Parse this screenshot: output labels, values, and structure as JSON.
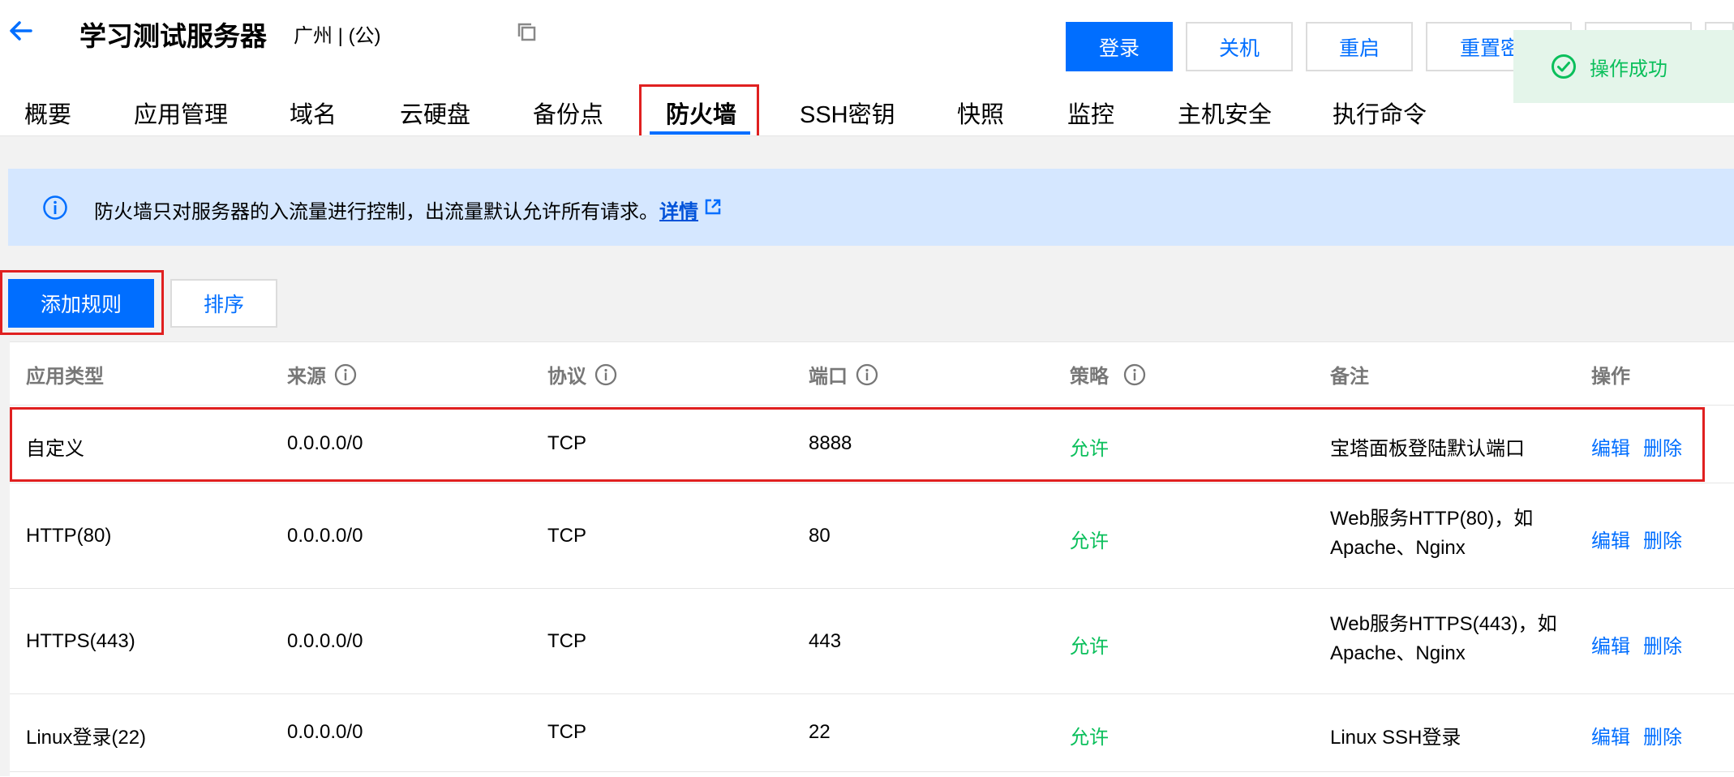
{
  "header": {
    "title": "学习测试服务器",
    "region": "广州 | (公)",
    "buttons": [
      "登录",
      "关机",
      "重启",
      "重置密",
      "",
      ""
    ]
  },
  "tabs": [
    "概要",
    "应用管理",
    "域名",
    "云硬盘",
    "备份点",
    "防火墙",
    "SSH密钥",
    "快照",
    "监控",
    "主机安全",
    "执行命令"
  ],
  "active_tab": "防火墙",
  "notice": {
    "text": "防火墙只对服务器的入流量进行控制，出流量默认允许所有请求。",
    "link": "详情"
  },
  "actions": {
    "add_rule": "添加规则",
    "sort": "排序"
  },
  "table": {
    "columns": [
      "应用类型",
      "来源",
      "协议",
      "端口",
      "策略",
      "备注",
      "操作"
    ],
    "rows": [
      {
        "app": "自定义",
        "source": "0.0.0.0/0",
        "protocol": "TCP",
        "port": "8888",
        "policy": "允许",
        "note": "宝塔面板登陆默认端口",
        "edit": "编辑",
        "delete": "删除"
      },
      {
        "app": "HTTP(80)",
        "source": "0.0.0.0/0",
        "protocol": "TCP",
        "port": "80",
        "policy": "允许",
        "note": "Web服务HTTP(80)，如Apache、Nginx",
        "edit": "编辑",
        "delete": "删除"
      },
      {
        "app": "HTTPS(443)",
        "source": "0.0.0.0/0",
        "protocol": "TCP",
        "port": "443",
        "policy": "允许",
        "note": "Web服务HTTPS(443)，如Apache、Nginx",
        "edit": "编辑",
        "delete": "删除"
      },
      {
        "app": "Linux登录(22)",
        "source": "0.0.0.0/0",
        "protocol": "TCP",
        "port": "22",
        "policy": "允许",
        "note": "Linux SSH登录",
        "edit": "编辑",
        "delete": "删除"
      }
    ]
  },
  "toast": {
    "text": "操作成功"
  },
  "colors": {
    "primary": "#006eff",
    "allow": "#0abf5b",
    "highlight": "#e02020",
    "notice_bg": "#d5e7ff",
    "toast_bg": "#e4f5ea"
  }
}
